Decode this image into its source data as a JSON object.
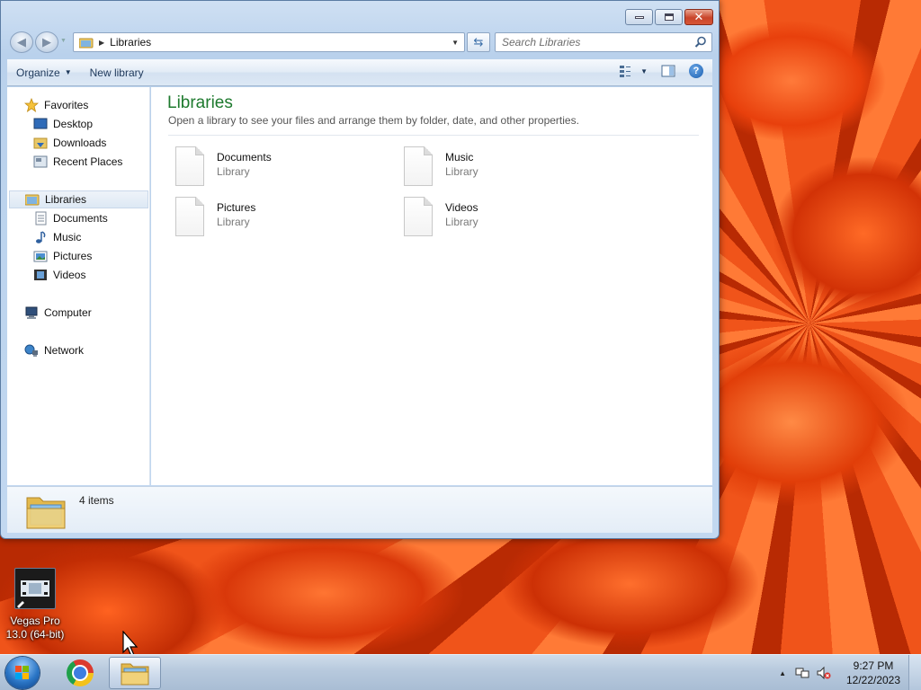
{
  "window": {
    "title_buttons": {
      "minimize": "minimize",
      "maximize": "maximize",
      "close": "close"
    }
  },
  "address_bar": {
    "crumb": "Libraries",
    "search_placeholder": "Search Libraries"
  },
  "command_bar": {
    "organize_label": "Organize",
    "new_library_label": "New library"
  },
  "nav_pane": {
    "favorites": {
      "label": "Favorites",
      "items": [
        "Desktop",
        "Downloads",
        "Recent Places"
      ]
    },
    "libraries": {
      "label": "Libraries",
      "items": [
        "Documents",
        "Music",
        "Pictures",
        "Videos"
      ]
    },
    "computer": "Computer",
    "network": "Network"
  },
  "content": {
    "title": "Libraries",
    "subtitle": "Open a library to see your files and arrange them by folder, date, and other properties.",
    "tiles": [
      {
        "name": "Documents",
        "kind": "Library"
      },
      {
        "name": "Music",
        "kind": "Library"
      },
      {
        "name": "Pictures",
        "kind": "Library"
      },
      {
        "name": "Videos",
        "kind": "Library"
      }
    ]
  },
  "details": {
    "count": "4 items"
  },
  "desktop": {
    "icons": [
      {
        "label_line1": "Vegas Pro",
        "label_line2": "13.0 (64-bit)"
      }
    ]
  },
  "taskbar": {
    "clock_time": "9:27 PM",
    "clock_date": "12/22/2023"
  },
  "colors": {
    "title_green": "#1e7a2e",
    "selection": "#dde8f4",
    "wallpaper": "#e8400c"
  }
}
